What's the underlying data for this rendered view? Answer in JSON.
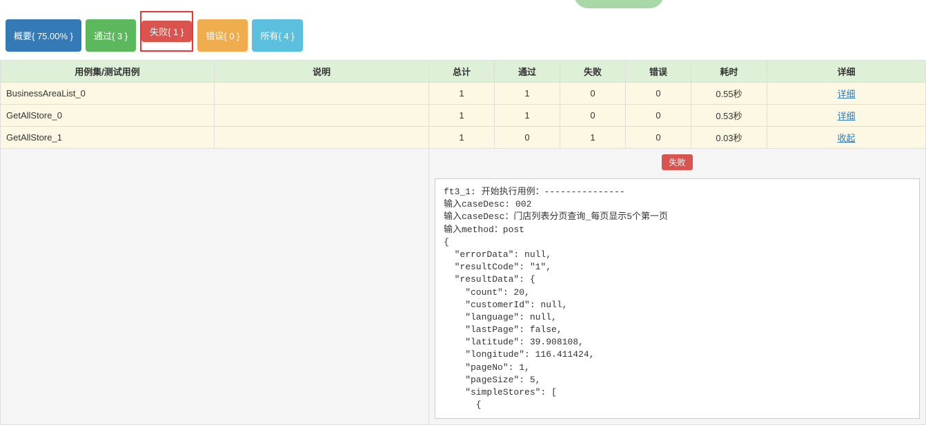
{
  "filters": {
    "summary": "概要{ 75.00% }",
    "pass": "通过{ 3 }",
    "fail": "失败{ 1 }",
    "error": "错误{ 0 }",
    "all": "所有{ 4 }"
  },
  "headers": {
    "case": "用例集/测试用例",
    "desc": "说明",
    "total": "总计",
    "pass": "通过",
    "fail": "失败",
    "error": "错误",
    "time": "耗时",
    "detail": "详细"
  },
  "rows": [
    {
      "name": "BusinessAreaList_0",
      "desc": "",
      "total": "1",
      "pass": "1",
      "fail": "0",
      "error": "0",
      "time": "0.55秒",
      "link": "详细"
    },
    {
      "name": "GetAllStore_0",
      "desc": "",
      "total": "1",
      "pass": "1",
      "fail": "0",
      "error": "0",
      "time": "0.53秒",
      "link": "详细"
    },
    {
      "name": "GetAllStore_1",
      "desc": "",
      "total": "1",
      "pass": "0",
      "fail": "1",
      "error": "0",
      "time": "0.03秒",
      "link": "收起"
    }
  ],
  "fail_badge": "失败",
  "detail_text": "ft3_1: 开始执行用例：---------------\n输入caseDesc: 002\n输入caseDesc：门店列表分页查询_每页显示5个第一页\n输入method：post\n{\n  \"errorData\": null,\n  \"resultCode\": \"1\",\n  \"resultData\": {\n    \"count\": 20,\n    \"customerId\": null,\n    \"language\": null,\n    \"lastPage\": false,\n    \"latitude\": 39.908108,\n    \"longitude\": 116.411424,\n    \"pageNo\": 1,\n    \"pageSize\": 5,\n    \"simpleStores\": [\n      {"
}
